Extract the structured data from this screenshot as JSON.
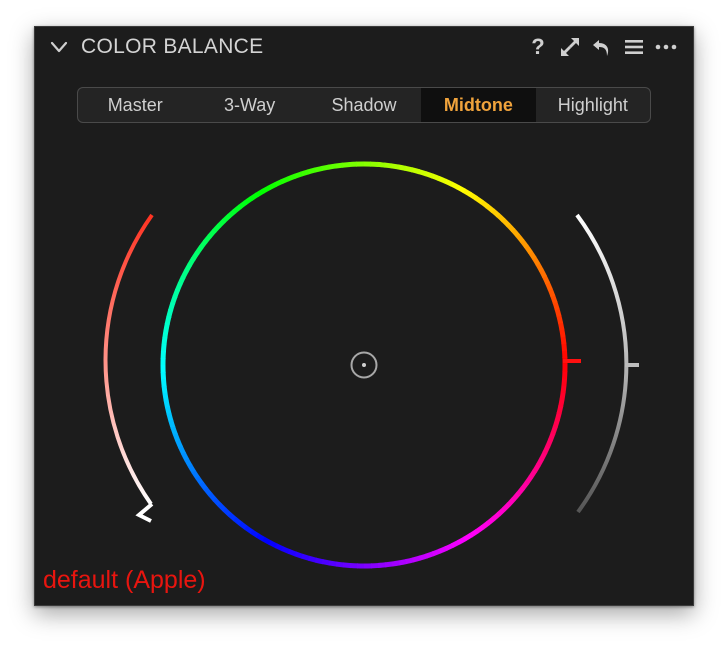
{
  "panel": {
    "title": "COLOR BALANCE",
    "help_glyph": "?",
    "icons": [
      "chevron-down-icon",
      "help-icon",
      "expand-icon",
      "reset-icon",
      "menu-icon",
      "more-icon"
    ]
  },
  "tabs": [
    {
      "label": "Master",
      "active": false
    },
    {
      "label": "3-Way",
      "active": false
    },
    {
      "label": "Shadow",
      "active": false
    },
    {
      "label": "Midtone",
      "active": true
    },
    {
      "label": "Highlight",
      "active": false
    }
  ],
  "colors": {
    "panel_bg": "#1c1c1c",
    "active_tab_text": "#f0a33c",
    "footer_text": "#e8150f",
    "left_slider_top": "#ff3322",
    "left_slider_bottom": "#ffffff",
    "right_slider_top": "#ffffff",
    "right_slider_bottom": "#555555"
  },
  "footer": {
    "label": "default (Apple)"
  }
}
